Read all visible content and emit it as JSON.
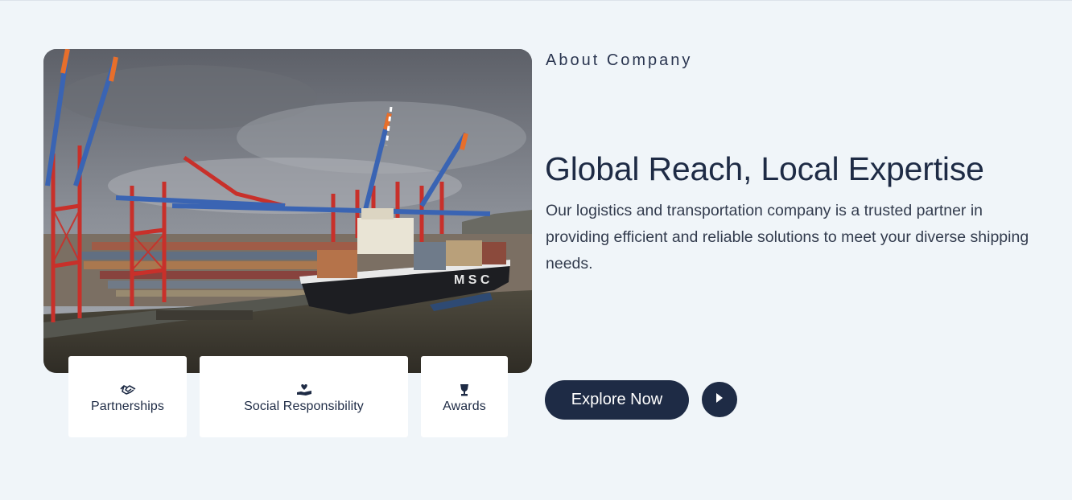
{
  "about": {
    "eyebrow": "About Company",
    "headline": "Global Reach, Local Expertise",
    "description": "Our logistics and transportation company is a trusted partner in providing efficient and reliable solutions to meet your diverse shipping needs."
  },
  "features": [
    {
      "label": "Partnerships",
      "icon": "handshake-icon"
    },
    {
      "label": "Social Responsibility",
      "icon": "heart-hand-icon"
    },
    {
      "label": "Awards",
      "icon": "trophy-icon"
    }
  ],
  "cta": {
    "explore_label": "Explore Now",
    "play_icon": "play-icon"
  },
  "image": {
    "ship_text": "M S C"
  },
  "colors": {
    "background": "#f0f5f9",
    "primary": "#1e2b45",
    "card": "#ffffff"
  }
}
